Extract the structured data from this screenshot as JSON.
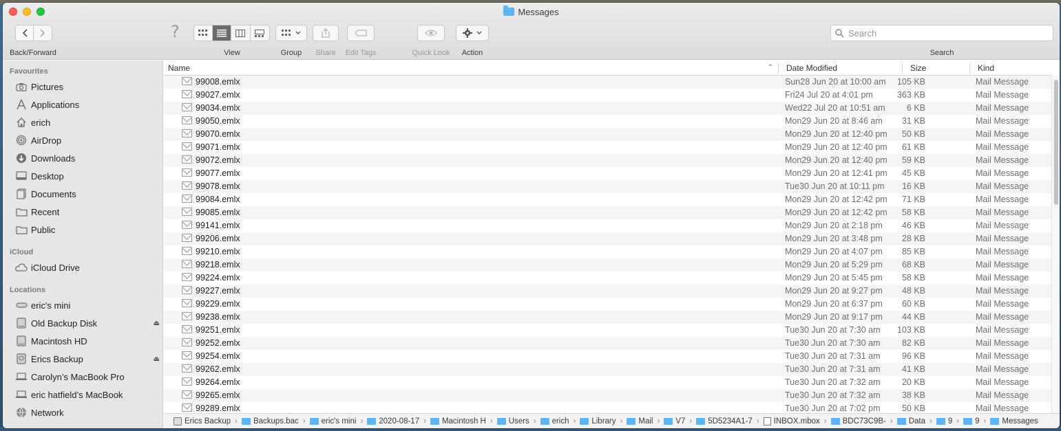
{
  "window": {
    "title": "Messages"
  },
  "toolbar": {
    "back_forward_label": "Back/Forward",
    "view_label": "View",
    "group_label": "Group",
    "share_label": "Share",
    "edit_tags_label": "Edit Tags",
    "quick_look_label": "Quick Look",
    "action_label": "Action",
    "search_label": "Search",
    "search_placeholder": "Search",
    "help_glyph": "?"
  },
  "sidebar": {
    "favourites_header": "Favourites",
    "favourites": [
      {
        "label": "Pictures",
        "icon": "camera-icon"
      },
      {
        "label": "Applications",
        "icon": "applications-icon"
      },
      {
        "label": "erich",
        "icon": "home-icon"
      },
      {
        "label": "AirDrop",
        "icon": "airdrop-icon"
      },
      {
        "label": "Downloads",
        "icon": "downloads-icon"
      },
      {
        "label": "Desktop",
        "icon": "desktop-icon"
      },
      {
        "label": "Documents",
        "icon": "documents-icon"
      },
      {
        "label": "Recent",
        "icon": "recent-folder-icon"
      },
      {
        "label": "Public",
        "icon": "folder-icon"
      }
    ],
    "icloud_header": "iCloud",
    "icloud": [
      {
        "label": "iCloud Drive",
        "icon": "cloud-icon"
      }
    ],
    "locations_header": "Locations",
    "locations": [
      {
        "label": "eric's mini",
        "icon": "mac-mini-icon",
        "eject": false
      },
      {
        "label": "Old Backup Disk",
        "icon": "disk-icon",
        "eject": true
      },
      {
        "label": "Macintosh HD",
        "icon": "disk-icon",
        "eject": false
      },
      {
        "label": "Erics Backup",
        "icon": "time-machine-disk-icon",
        "eject": true
      },
      {
        "label": "Carolyn’s MacBook Pro",
        "icon": "laptop-icon",
        "eject": false
      },
      {
        "label": "eric hatfield’s MacBook",
        "icon": "laptop-icon",
        "eject": false
      },
      {
        "label": "Network",
        "icon": "network-icon",
        "eject": false
      }
    ],
    "eject_glyph": "⏏"
  },
  "columns": {
    "name": "Name",
    "date": "Date Modified",
    "size": "Size",
    "kind": "Kind",
    "sort_glyph": "⌃"
  },
  "files": [
    {
      "name": "99008.emlx",
      "date": "Sun28 Jun 20 at 10:00 am",
      "size": "105 KB",
      "kind": "Mail Message"
    },
    {
      "name": "99027.emlx",
      "date": "Fri24 Jul 20 at 4:01 pm",
      "size": "363 KB",
      "kind": "Mail Message"
    },
    {
      "name": "99034.emlx",
      "date": "Wed22 Jul 20 at 10:51 am",
      "size": "6 KB",
      "kind": "Mail Message"
    },
    {
      "name": "99050.emlx",
      "date": "Mon29 Jun 20 at 8:46 am",
      "size": "31 KB",
      "kind": "Mail Message"
    },
    {
      "name": "99070.emlx",
      "date": "Mon29 Jun 20 at 12:40 pm",
      "size": "50 KB",
      "kind": "Mail Message"
    },
    {
      "name": "99071.emlx",
      "date": "Mon29 Jun 20 at 12:40 pm",
      "size": "61 KB",
      "kind": "Mail Message"
    },
    {
      "name": "99072.emlx",
      "date": "Mon29 Jun 20 at 12:40 pm",
      "size": "59 KB",
      "kind": "Mail Message"
    },
    {
      "name": "99077.emlx",
      "date": "Mon29 Jun 20 at 12:41 pm",
      "size": "45 KB",
      "kind": "Mail Message"
    },
    {
      "name": "99078.emlx",
      "date": "Tue30 Jun 20 at 10:11 pm",
      "size": "16 KB",
      "kind": "Mail Message"
    },
    {
      "name": "99084.emlx",
      "date": "Mon29 Jun 20 at 12:42 pm",
      "size": "71 KB",
      "kind": "Mail Message"
    },
    {
      "name": "99085.emlx",
      "date": "Mon29 Jun 20 at 12:42 pm",
      "size": "58 KB",
      "kind": "Mail Message"
    },
    {
      "name": "99141.emlx",
      "date": "Mon29 Jun 20 at 2:18 pm",
      "size": "46 KB",
      "kind": "Mail Message"
    },
    {
      "name": "99206.emlx",
      "date": "Mon29 Jun 20 at 3:48 pm",
      "size": "28 KB",
      "kind": "Mail Message"
    },
    {
      "name": "99210.emlx",
      "date": "Mon29 Jun 20 at 4:07 pm",
      "size": "85 KB",
      "kind": "Mail Message"
    },
    {
      "name": "99218.emlx",
      "date": "Mon29 Jun 20 at 5:29 pm",
      "size": "68 KB",
      "kind": "Mail Message"
    },
    {
      "name": "99224.emlx",
      "date": "Mon29 Jun 20 at 5:45 pm",
      "size": "58 KB",
      "kind": "Mail Message"
    },
    {
      "name": "99227.emlx",
      "date": "Mon29 Jun 20 at 9:27 pm",
      "size": "48 KB",
      "kind": "Mail Message"
    },
    {
      "name": "99229.emlx",
      "date": "Mon29 Jun 20 at 6:37 pm",
      "size": "60 KB",
      "kind": "Mail Message"
    },
    {
      "name": "99238.emlx",
      "date": "Mon29 Jun 20 at 9:17 pm",
      "size": "44 KB",
      "kind": "Mail Message"
    },
    {
      "name": "99251.emlx",
      "date": "Tue30 Jun 20 at 7:30 am",
      "size": "103 KB",
      "kind": "Mail Message"
    },
    {
      "name": "99252.emlx",
      "date": "Tue30 Jun 20 at 7:30 am",
      "size": "82 KB",
      "kind": "Mail Message"
    },
    {
      "name": "99254.emlx",
      "date": "Tue30 Jun 20 at 7:31 am",
      "size": "96 KB",
      "kind": "Mail Message"
    },
    {
      "name": "99262.emlx",
      "date": "Tue30 Jun 20 at 7:31 am",
      "size": "41 KB",
      "kind": "Mail Message"
    },
    {
      "name": "99264.emlx",
      "date": "Tue30 Jun 20 at 7:32 am",
      "size": "20 KB",
      "kind": "Mail Message"
    },
    {
      "name": "99265.emlx",
      "date": "Tue30 Jun 20 at 7:32 am",
      "size": "38 KB",
      "kind": "Mail Message"
    },
    {
      "name": "99289.emlx",
      "date": "Tue30 Jun 20 at 7:02 pm",
      "size": "50 KB",
      "kind": "Mail Message"
    }
  ],
  "pathbar": [
    {
      "label": "Erics Backup",
      "icon": "disk-icon"
    },
    {
      "label": "Backups.bac",
      "icon": "folder-icon"
    },
    {
      "label": "eric's mini",
      "icon": "folder-icon"
    },
    {
      "label": "2020-08-17",
      "icon": "folder-icon"
    },
    {
      "label": "Macintosh H",
      "icon": "folder-icon"
    },
    {
      "label": "Users",
      "icon": "folder-icon"
    },
    {
      "label": "erich",
      "icon": "folder-icon"
    },
    {
      "label": "Library",
      "icon": "folder-icon"
    },
    {
      "label": "Mail",
      "icon": "folder-icon"
    },
    {
      "label": "V7",
      "icon": "folder-icon"
    },
    {
      "label": "5D5234A1-7",
      "icon": "folder-icon"
    },
    {
      "label": "INBOX.mbox",
      "icon": "mailbox-icon"
    },
    {
      "label": "BDC73C9B-",
      "icon": "folder-icon"
    },
    {
      "label": "Data",
      "icon": "folder-icon"
    },
    {
      "label": "9",
      "icon": "folder-icon"
    },
    {
      "label": "9",
      "icon": "folder-icon"
    },
    {
      "label": "Messages",
      "icon": "folder-icon"
    }
  ],
  "pathbar_separator": "›"
}
